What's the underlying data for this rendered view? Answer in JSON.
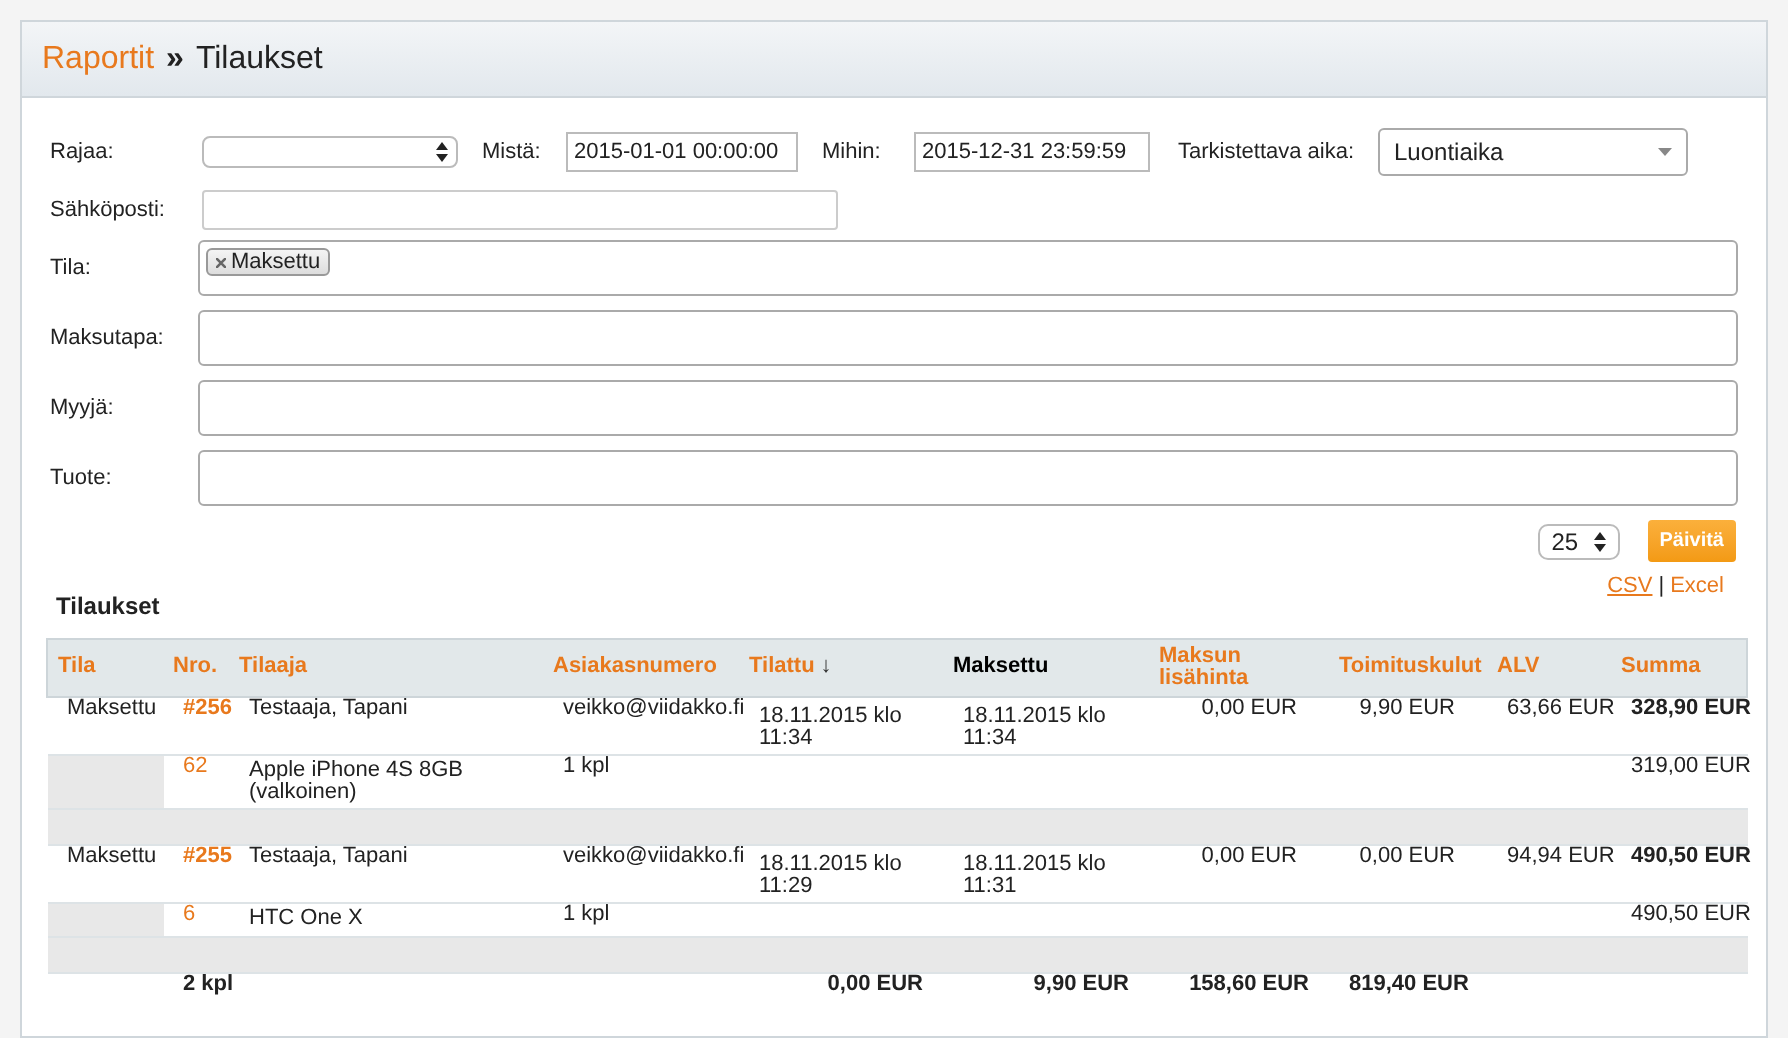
{
  "header": {
    "breadcrumb_link": "Raportit",
    "separator": "»",
    "title": "Tilaukset"
  },
  "filters": {
    "rajaa": {
      "label": "Rajaa:"
    },
    "from": {
      "label": "Mistä:",
      "value": "2015-01-01 00:00:00"
    },
    "to": {
      "label": "Mihin:",
      "value": "2015-12-31 23:59:59"
    },
    "time_field": {
      "label": "Tarkistettava aika:",
      "value": "Luontiaika"
    },
    "email": {
      "label": "Sähköposti:"
    },
    "multi": [
      {
        "label": "Tila:",
        "tags": [
          "Maksettu"
        ]
      },
      {
        "label": "Maksutapa:"
      },
      {
        "label": "Myyjä:"
      },
      {
        "label": "Tuote:"
      }
    ]
  },
  "page_size": "25",
  "update_button": "Päivitä",
  "section_title": "Tilaukset",
  "exports": [
    "CSV",
    "Excel"
  ],
  "export_separator": "|",
  "table": {
    "columns": [
      {
        "label": "Tila",
        "link": true
      },
      {
        "label": "Nro.",
        "link": true
      },
      {
        "label": "Tilaaja",
        "link": true
      },
      {
        "label": "Asiakasnumero",
        "link": true
      },
      {
        "label": "Tilattu",
        "link": true,
        "sort": "↓"
      },
      {
        "label": "Maksettu",
        "link": false
      },
      {
        "label": "Maksun lisähinta",
        "link": true
      },
      {
        "label": "Toimituskulut",
        "link": true
      },
      {
        "label": "ALV",
        "link": true
      },
      {
        "label": "Summa",
        "link": true
      }
    ],
    "orders": [
      {
        "status": "Maksettu",
        "number": "#256",
        "customer": "Testaaja, Tapani",
        "email": "veikko@viidakko.fi",
        "ordered": "18.11.2015 klo 11:34",
        "paid": "18.11.2015 klo 11:34",
        "payment_fee": "0,00 EUR",
        "shipping": "9,90 EUR",
        "vat": "63,66 EUR",
        "total": "328,90 EUR",
        "items": [
          {
            "id": "62",
            "name": "Apple iPhone 4S 8GB (valkoinen)",
            "qty": "1 kpl",
            "total": "319,00 EUR"
          }
        ]
      },
      {
        "status": "Maksettu",
        "number": "#255",
        "customer": "Testaaja, Tapani",
        "email": "veikko@viidakko.fi",
        "ordered": "18.11.2015 klo 11:29",
        "paid": "18.11.2015 klo 11:31",
        "payment_fee": "0,00 EUR",
        "shipping": "0,00 EUR",
        "vat": "94,94 EUR",
        "total": "490,50 EUR",
        "items": [
          {
            "id": "6",
            "name": "HTC One X",
            "qty": "1 kpl",
            "total": "490,50 EUR"
          }
        ]
      }
    ],
    "totals": {
      "quantity": "2 kpl",
      "values": [
        "0,00 EUR",
        "9,90 EUR",
        "158,60 EUR",
        "819,40 EUR"
      ]
    }
  }
}
